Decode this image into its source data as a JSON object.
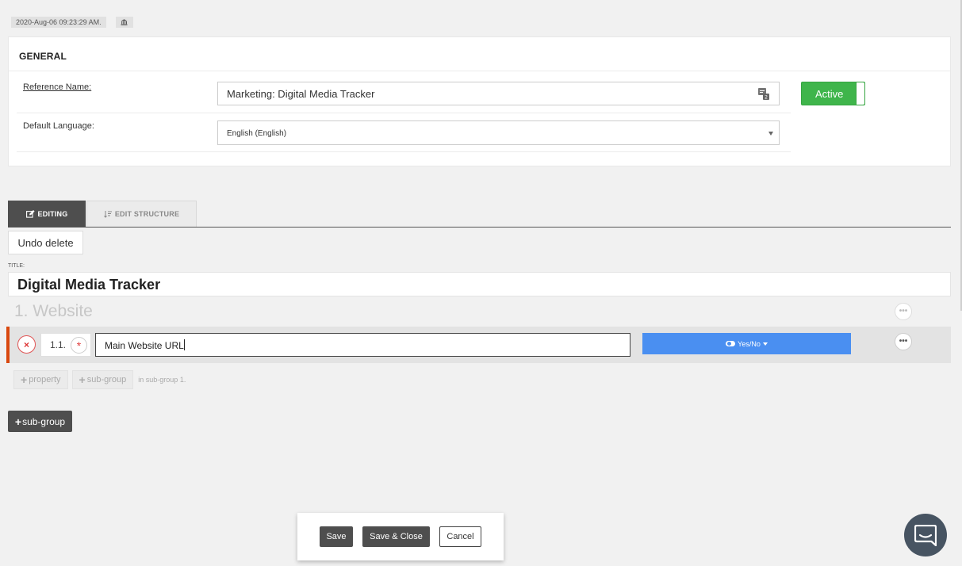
{
  "header": {
    "timestamp": "2020-Aug-06 09:23:29 AM.",
    "bank_icon": "bank-icon"
  },
  "general": {
    "title": "GENERAL",
    "reference_name_label": "Reference Name:",
    "reference_name_value": "Marketing: Digital Media Tracker",
    "default_language_label": "Default Language:",
    "default_language_value": "English (English)",
    "status_label": "Active",
    "status_color": "#3fb54b"
  },
  "tabs": {
    "editing_label": "EDITING",
    "edit_structure_label": "EDIT STRUCTURE"
  },
  "toolbar": {
    "undo_label": "Undo delete"
  },
  "form": {
    "title_label": "TITLE:",
    "title_value": "Digital Media Tracker",
    "group_heading": "1. Website",
    "more_glyph": "•••",
    "property": {
      "number": "1.1.",
      "required_mark": "*",
      "remove_glyph": "×",
      "value": "Main Website URL",
      "type_label": "Yes/No",
      "type_color": "#4a8ff1"
    },
    "add_property_label": "property",
    "add_subgroup_inline_label": "sub-group",
    "add_hint": "in sub-group 1.",
    "add_subgroup_label": "sub-group"
  },
  "footer": {
    "save_label": "Save",
    "save_close_label": "Save & Close",
    "cancel_label": "Cancel"
  },
  "chat": {
    "icon": "chat-icon"
  }
}
